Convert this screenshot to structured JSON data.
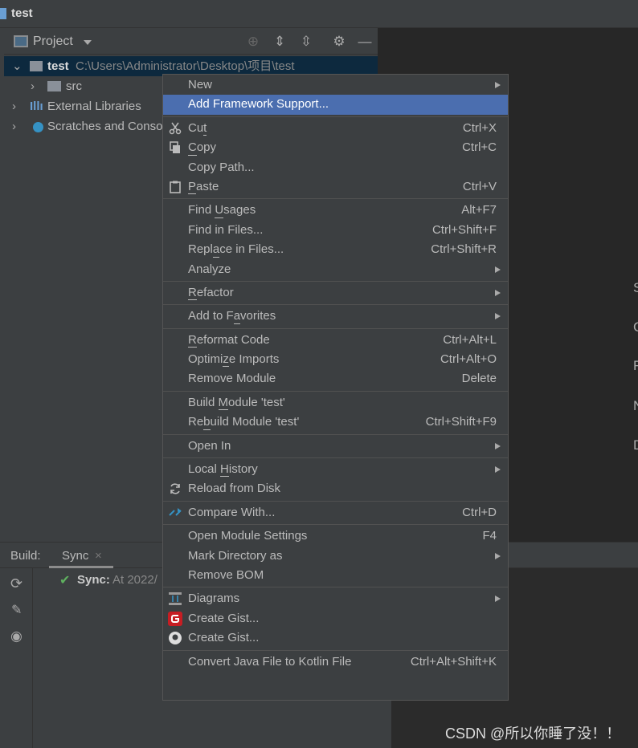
{
  "window": {
    "title": "test"
  },
  "project_panel": {
    "title": "Project",
    "tree": [
      {
        "name": "test",
        "path": "C:\\Users\\Administrator\\Desktop\\项目\\test",
        "selected": true
      },
      {
        "name": "src"
      },
      {
        "name": "External Libraries"
      },
      {
        "name": "Scratches and Consoles"
      }
    ]
  },
  "editor_hints": [
    "S",
    "C",
    "F",
    "N",
    "D"
  ],
  "build_panel": {
    "label": "Build:",
    "tab": "Sync",
    "sync_label": "Sync:",
    "sync_text": "At 2022/"
  },
  "menu": [
    {
      "label": "New",
      "sub": true
    },
    {
      "label": "Add Framework Support...",
      "highlighted": true
    },
    {
      "sep": true
    },
    {
      "label": "Cut",
      "mn": 2,
      "sc": "Ctrl+X",
      "icon": "scissors-icon"
    },
    {
      "label": "Copy",
      "mn": 0,
      "sc": "Ctrl+C",
      "icon": "copy-icon"
    },
    {
      "label": "Copy Path...",
      "sc": ""
    },
    {
      "label": "Paste",
      "mn": 0,
      "sc": "Ctrl+V",
      "icon": "clipboard-icon"
    },
    {
      "sep": true
    },
    {
      "label": "Find Usages",
      "mn": 5,
      "sc": "Alt+F7"
    },
    {
      "label": "Find in Files...",
      "sc": "Ctrl+Shift+F"
    },
    {
      "label": "Replace in Files...",
      "mn": 4,
      "sc": "Ctrl+Shift+R"
    },
    {
      "label": "Analyze",
      "sub": true
    },
    {
      "sep": true
    },
    {
      "label": "Refactor",
      "mn": 0,
      "sub": true
    },
    {
      "sep": true
    },
    {
      "label": "Add to Favorites",
      "mn": 8,
      "sub": true
    },
    {
      "sep": true
    },
    {
      "label": "Reformat Code",
      "mn": 0,
      "sc": "Ctrl+Alt+L"
    },
    {
      "label": "Optimize Imports",
      "mn": 6,
      "sc": "Ctrl+Alt+O"
    },
    {
      "label": "Remove Module",
      "sc": "Delete"
    },
    {
      "sep": true
    },
    {
      "label": "Build Module 'test'",
      "mn": 6
    },
    {
      "label": "Rebuild Module 'test'",
      "mn": 2,
      "sc": "Ctrl+Shift+F9"
    },
    {
      "sep": true
    },
    {
      "label": "Open In",
      "sub": true
    },
    {
      "sep": true
    },
    {
      "label": "Local History",
      "mn": 6,
      "sub": true
    },
    {
      "label": "Reload from Disk",
      "icon": "reload-icon"
    },
    {
      "sep": true
    },
    {
      "label": "Compare With...",
      "sc": "Ctrl+D",
      "icon": "compare-icon"
    },
    {
      "sep": true
    },
    {
      "label": "Open Module Settings",
      "sc": "F4"
    },
    {
      "label": "Mark Directory as",
      "sub": true
    },
    {
      "label": "Remove BOM"
    },
    {
      "sep": true
    },
    {
      "label": "Diagrams",
      "sub": true,
      "icon": "diagram-icon"
    },
    {
      "label": "Create Gist...",
      "icon": "gitee-icon"
    },
    {
      "label": "Create Gist...",
      "icon": "github-icon"
    },
    {
      "sep": true
    },
    {
      "label": "Convert Java File to Kotlin File",
      "sc": "Ctrl+Alt+Shift+K"
    }
  ],
  "colors": {
    "highlight": "#4b6eaf",
    "background": "#3c3f41",
    "editor": "#272727",
    "selected_row": "#0d293e"
  },
  "watermark": "CSDN @所以你睡了没！！"
}
